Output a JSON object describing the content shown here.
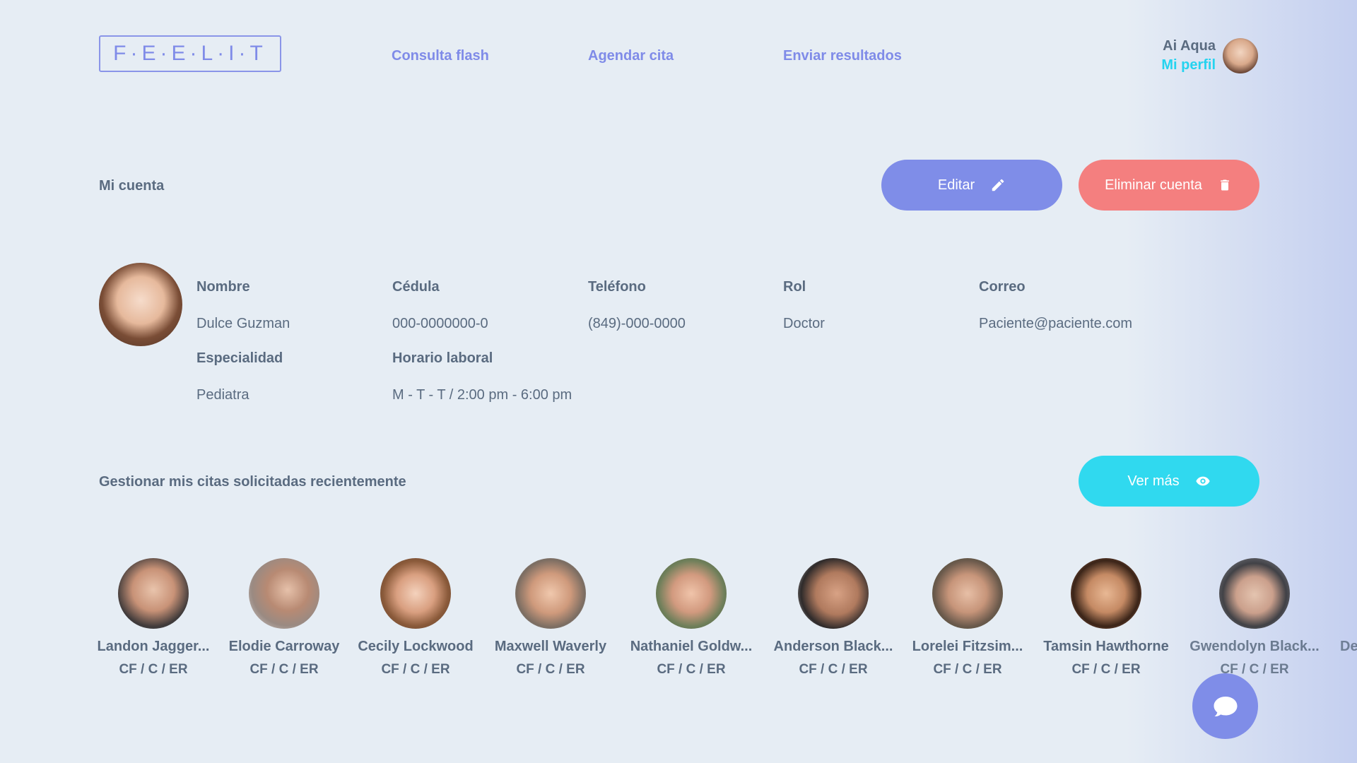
{
  "header": {
    "logo": "F·E·E·L·I·T",
    "nav": [
      "Consulta flash",
      "Agendar cita",
      "Enviar resultados"
    ],
    "user_name": "Ai Aqua",
    "profile_link": "Mi perfil"
  },
  "account": {
    "title": "Mi cuenta",
    "edit_label": "Editar",
    "delete_label": "Eliminar cuenta",
    "fields": [
      {
        "label": "Nombre",
        "value": "Dulce Guzman"
      },
      {
        "label": "Cédula",
        "value": "000-0000000-0"
      },
      {
        "label": "Teléfono",
        "value": "(849)-000-0000"
      },
      {
        "label": "Rol",
        "value": "Doctor"
      },
      {
        "label": "Correo",
        "value": "Paciente@paciente.com"
      },
      {
        "label": "Especialidad",
        "value": "Pediatra"
      },
      {
        "label": "Horario laboral",
        "value": "M - T - T / 2:00 pm - 6:00 pm"
      }
    ]
  },
  "appointments": {
    "title": "Gestionar mis citas solicitadas recientemente",
    "more_label": "Ver más",
    "items": [
      {
        "name": "Landon Jagger...",
        "sub": "CF / C / ER"
      },
      {
        "name": "Elodie Carroway",
        "sub": "CF / C / ER"
      },
      {
        "name": "Cecily Lockwood",
        "sub": "CF / C / ER"
      },
      {
        "name": "Maxwell Waverly",
        "sub": "CF / C / ER"
      },
      {
        "name": "Nathaniel Goldw...",
        "sub": "CF / C / ER"
      },
      {
        "name": "Anderson Black...",
        "sub": "CF / C / ER"
      },
      {
        "name": "Lorelei Fitzsim...",
        "sub": "CF / C / ER"
      },
      {
        "name": "Tamsin Hawthorne",
        "sub": "CF / C / ER"
      },
      {
        "name": "Gwendolyn Black...",
        "sub": "CF / C / ER"
      },
      {
        "name": "De",
        "sub": ""
      }
    ]
  },
  "icons": {
    "edit": "pencil-icon",
    "delete": "trash-icon",
    "more": "eye-icon",
    "chat": "chat-bubble-icon"
  },
  "colors": {
    "primary": "#7f8de8",
    "danger": "#f47f7f",
    "accent": "#30d9ef",
    "text": "#5a6b80"
  }
}
